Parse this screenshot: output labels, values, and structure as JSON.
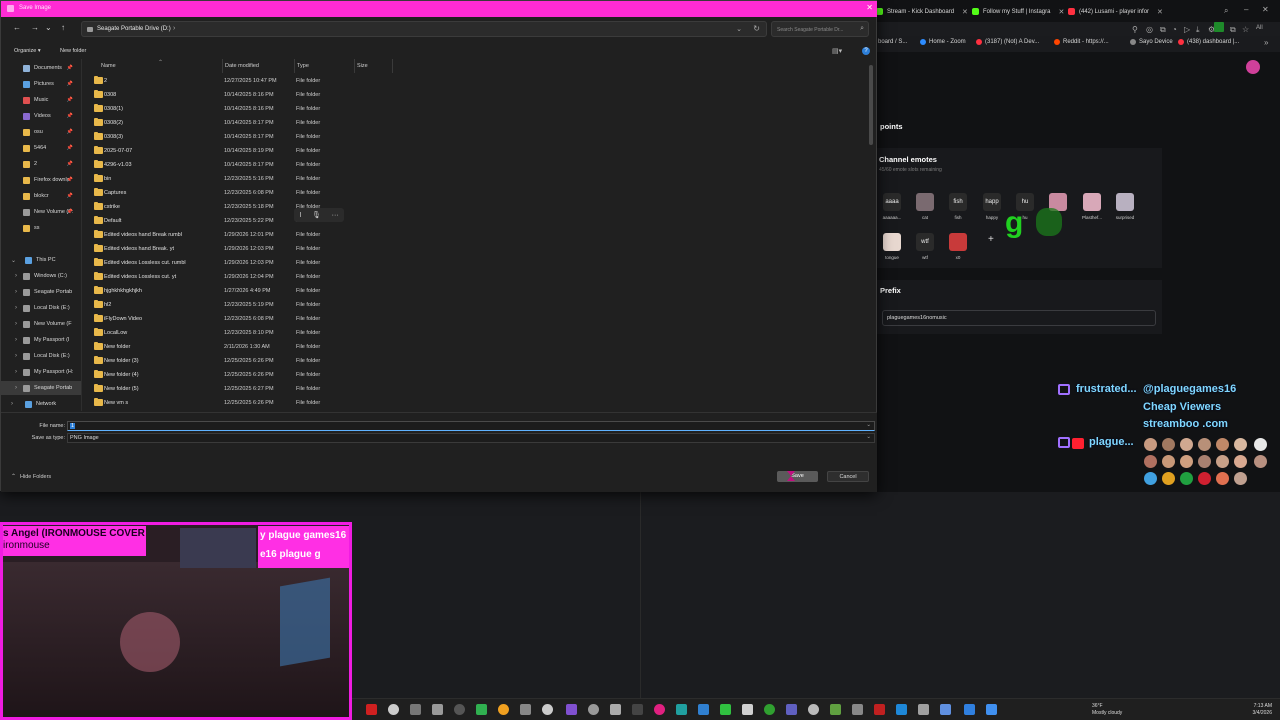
{
  "browser": {
    "tabs": [
      {
        "label": "Stream - Kick Dashboard",
        "color": "#53fc18"
      },
      {
        "label": "Follow my Stuff | Instagra",
        "color": "#53fc18"
      },
      {
        "label": "(442) Lusami - player infor",
        "color": "#ff3040"
      }
    ],
    "bookmarks": [
      {
        "label": "board / S...",
        "color": "#53fc18"
      },
      {
        "label": "Home - Zoom",
        "color": "#2d8cff"
      },
      {
        "label": "(3187) (Not) A Dev...",
        "color": "#ff3040"
      },
      {
        "label": "Reddit - https://...",
        "color": "#ff4500"
      },
      {
        "label": "Sayo Device",
        "color": "#888888"
      },
      {
        "label": "(438) dashboard |...",
        "color": "#ff3040"
      }
    ],
    "all_label": "All"
  },
  "kick": {
    "points_title": "points",
    "emotes_title": "Channel emotes",
    "emotes_sub": "45/60 emote slots remaining",
    "emotes": [
      {
        "img": "aaaa",
        "label": "aaaaaa...",
        "color": "#2a2a2a"
      },
      {
        "img": "",
        "label": "cat",
        "color": "#7a6a70"
      },
      {
        "img": "fish",
        "label": "fish",
        "color": "#2a2a2a"
      },
      {
        "img": "happ",
        "label": "happy",
        "color": "#2a2a2a"
      },
      {
        "img": "hu",
        "label": "hu",
        "color": "#2a2a2a"
      },
      {
        "img": "",
        "label": "",
        "color": "#c98aa0"
      },
      {
        "img": "",
        "label": "Plasthef...",
        "color": "#d8a8b8"
      },
      {
        "img": "",
        "label": "surprised",
        "color": "#b8b0c0"
      },
      {
        "img": "",
        "label": "tongue",
        "color": "#e8d8d0"
      },
      {
        "img": "wtf",
        "label": "wtf",
        "color": "#2a2a2a"
      },
      {
        "img": "",
        "label": "x0",
        "color": "#c83a3a"
      }
    ],
    "add_label": "+",
    "overlay_g": "g",
    "prefix_title": "Prefix",
    "prefix_value": "plaguegames16nomusic"
  },
  "overlay": {
    "line1_user": "frustrated...",
    "line1_handle": "@plaguegames16",
    "line2": "Cheap Viewers",
    "line3": "streamboo .com",
    "line4_user": "plague..."
  },
  "webcam": {
    "title_line1": "s Angel (IRONMOUSE COVER",
    "title_line2": "ironmouse",
    "pg_line1": "y plague games16",
    "pg_line2": "e16 plague g"
  },
  "dialog": {
    "title": "Save Image",
    "close": "✕",
    "address": "Seagate Portable Drive (D:)",
    "search_placeholder": "Search Seagate Portable Dr...",
    "organize": "Organize ▾",
    "new_folder": "New folder",
    "nav": [
      {
        "label": "Documents",
        "pin": true,
        "color": "#8fb2d8"
      },
      {
        "label": "Pictures",
        "pin": true,
        "color": "#5aa0e0"
      },
      {
        "label": "Music",
        "pin": true,
        "color": "#e05050"
      },
      {
        "label": "Videos",
        "pin": true,
        "color": "#8a6ad0"
      },
      {
        "label": "osu",
        "pin": true,
        "color": "#e8b84a"
      },
      {
        "label": "5464",
        "pin": true,
        "color": "#e8b84a"
      },
      {
        "label": "2",
        "pin": true,
        "color": "#e8b84a"
      },
      {
        "label": "Firefox downlo",
        "pin": true,
        "color": "#e8b84a"
      },
      {
        "label": "blokcr",
        "pin": true,
        "color": "#e8b84a"
      },
      {
        "label": "New Volume (F:",
        "pin": true,
        "color": "#9a9a9a"
      },
      {
        "label": "ss",
        "pin": false,
        "color": "#e8b84a"
      },
      {
        "label": "",
        "pin": false,
        "color": "transparent"
      },
      {
        "label": "This PC",
        "pin": false,
        "color": "#5aa0e0"
      },
      {
        "label": "Windows (C:)",
        "pin": false,
        "color": "#9a9a9a"
      },
      {
        "label": "Seagate Portab",
        "pin": false,
        "color": "#9a9a9a"
      },
      {
        "label": "Local Disk (E:)",
        "pin": false,
        "color": "#9a9a9a"
      },
      {
        "label": "New Volume (F",
        "pin": false,
        "color": "#9a9a9a"
      },
      {
        "label": "My Passport (I",
        "pin": false,
        "color": "#9a9a9a"
      },
      {
        "label": "Local Disk (E:)",
        "pin": false,
        "color": "#9a9a9a"
      },
      {
        "label": "My Passport (H:",
        "pin": false,
        "color": "#9a9a9a"
      },
      {
        "label": "Seagate Portab",
        "pin": false,
        "color": "#9a9a9a"
      },
      {
        "label": "Network",
        "pin": false,
        "color": "#5aa0e0"
      }
    ],
    "columns": {
      "name": "Name",
      "date": "Date modified",
      "type": "Type",
      "size": "Size"
    },
    "files": [
      {
        "name": "2",
        "date": "12/27/2025 10:47 PM",
        "type": "File folder"
      },
      {
        "name": "0308",
        "date": "10/14/2025 8:16 PM",
        "type": "File folder"
      },
      {
        "name": "0308(1)",
        "date": "10/14/2025 8:16 PM",
        "type": "File folder"
      },
      {
        "name": "0308(2)",
        "date": "10/14/2025 8:17 PM",
        "type": "File folder"
      },
      {
        "name": "0308(3)",
        "date": "10/14/2025 8:17 PM",
        "type": "File folder"
      },
      {
        "name": "2025-07-07",
        "date": "10/14/2025 8:19 PM",
        "type": "File folder"
      },
      {
        "name": "4296-v1.03",
        "date": "10/14/2025 8:17 PM",
        "type": "File folder"
      },
      {
        "name": "bin",
        "date": "12/23/2025 5:16 PM",
        "type": "File folder"
      },
      {
        "name": "Captures",
        "date": "12/23/2025 6:08 PM",
        "type": "File folder"
      },
      {
        "name": "cstrike",
        "date": "12/23/2025 5:18 PM",
        "type": "File folder"
      },
      {
        "name": "Default",
        "date": "12/23/2025 5:22 PM",
        "type": "File folder"
      },
      {
        "name": "Edited videos hand Break rumbl",
        "date": "1/29/2026 12:01 PM",
        "type": "File folder"
      },
      {
        "name": "Edited videos hand Break. yt",
        "date": "1/29/2026 12:03 PM",
        "type": "File folder"
      },
      {
        "name": "Edited videos Lossless cut. rumbl",
        "date": "1/29/2026 12:03 PM",
        "type": "File folder"
      },
      {
        "name": "Edited videos Lossless cut. yt",
        "date": "1/29/2026 12:04 PM",
        "type": "File folder"
      },
      {
        "name": "hjghkhkhgkhjkh",
        "date": "1/27/2026 4:49 PM",
        "type": "File folder"
      },
      {
        "name": "hl2",
        "date": "12/23/2025 5:19 PM",
        "type": "File folder"
      },
      {
        "name": "iFlyDown Video",
        "date": "12/23/2025 6:08 PM",
        "type": "File folder"
      },
      {
        "name": "LocalLow",
        "date": "12/23/2025 8:10 PM",
        "type": "File folder"
      },
      {
        "name": "New folder",
        "date": "2/11/2026 1:30 AM",
        "type": "File folder"
      },
      {
        "name": "New folder (3)",
        "date": "12/25/2025 6:26 PM",
        "type": "File folder"
      },
      {
        "name": "New folder (4)",
        "date": "12/25/2025 6:26 PM",
        "type": "File folder"
      },
      {
        "name": "New folder (5)",
        "date": "12/25/2025 6:27 PM",
        "type": "File folder"
      },
      {
        "name": "New vm s",
        "date": "12/25/2025 6:26 PM",
        "type": "File folder"
      }
    ],
    "file_name_label": "File name:",
    "file_name_value": "1",
    "save_type_label": "Save as type:",
    "save_type_value": "PNG Image",
    "hide_folders": "Hide Folders",
    "save": "Save",
    "cancel": "Cancel"
  },
  "taskbar": {
    "weather_temp": "36°F",
    "weather_desc": "Mostly cloudy",
    "time": "7:13 AM",
    "date": "3/4/2026"
  }
}
